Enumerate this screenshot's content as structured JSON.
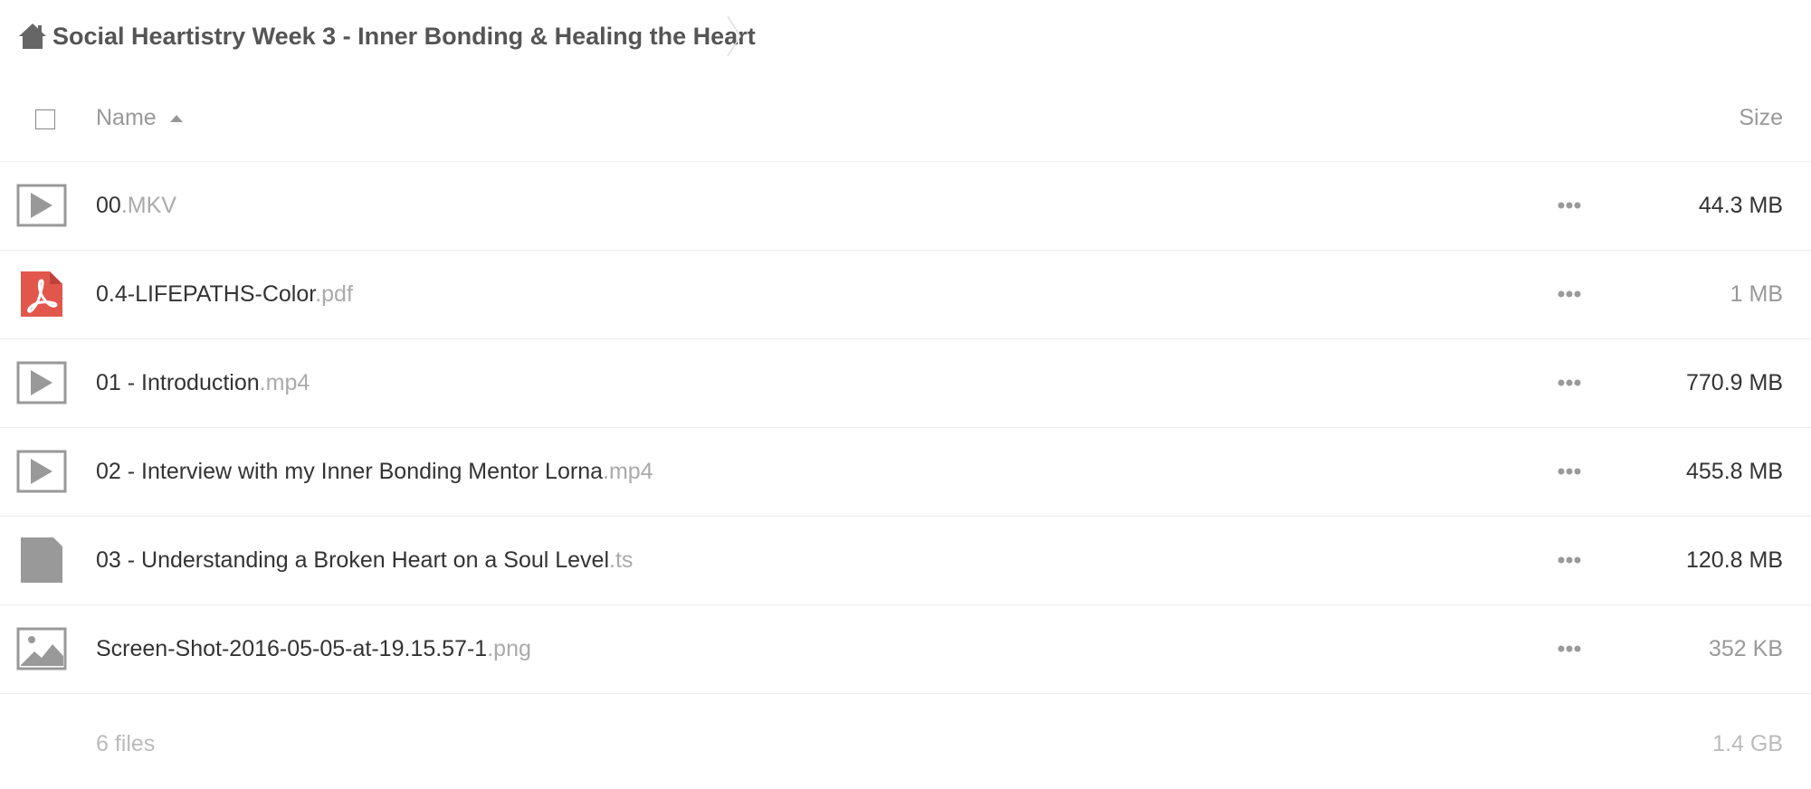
{
  "breadcrumb": {
    "title": "Social Heartistry Week 3 - Inner Bonding & Healing the Heart",
    "home_icon": "home-icon"
  },
  "header": {
    "name_label": "Name",
    "size_label": "Size",
    "sort": "ascending"
  },
  "files": [
    {
      "base": "00",
      "ext": ".MKV",
      "size": "44.3 MB",
      "icon": "video-icon",
      "size_muted": false
    },
    {
      "base": "0.4-LIFEPATHS-Color",
      "ext": ".pdf",
      "size": "1 MB",
      "icon": "pdf-icon",
      "size_muted": true
    },
    {
      "base": "01 - Introduction",
      "ext": ".mp4",
      "size": "770.9 MB",
      "icon": "video-icon",
      "size_muted": false
    },
    {
      "base": "02 - Interview with my Inner Bonding Mentor Lorna",
      "ext": ".mp4",
      "size": "455.8 MB",
      "icon": "video-icon",
      "size_muted": false
    },
    {
      "base": "03 - Understanding a Broken Heart on a Soul Level",
      "ext": ".ts",
      "size": "120.8 MB",
      "icon": "file-icon",
      "size_muted": false
    },
    {
      "base": "Screen-Shot-2016-05-05-at-19.15.57-1",
      "ext": ".png",
      "size": "352 KB",
      "icon": "image-icon",
      "size_muted": true
    }
  ],
  "summary": {
    "count": "6 files",
    "total_size": "1.4 GB"
  },
  "colors": {
    "pdf_red": "#e2574c",
    "icon_gray": "#999999"
  }
}
